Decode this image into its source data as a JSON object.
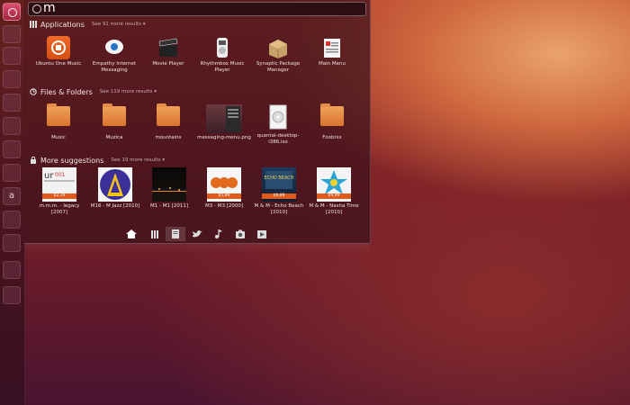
{
  "search": {
    "value": "m"
  },
  "launcher": {
    "letter_icon": "a"
  },
  "applications": {
    "title": "Applications",
    "more": "See 91 more results",
    "items": [
      {
        "label": "Ubuntu One Music",
        "icon": "ubuntu-one-music-icon"
      },
      {
        "label": "Empathy Internet Messaging",
        "icon": "empathy-icon"
      },
      {
        "label": "Movie Player",
        "icon": "clapperboard-icon"
      },
      {
        "label": "Rhythmbox Music Player",
        "icon": "rhythmbox-icon"
      },
      {
        "label": "Synaptic Package Manager",
        "icon": "package-icon"
      },
      {
        "label": "Main Menu",
        "icon": "main-menu-icon"
      }
    ]
  },
  "files": {
    "title": "Files & Folders",
    "more": "See 119 more results",
    "items": [
      {
        "label": "Music"
      },
      {
        "label": "Muzica"
      },
      {
        "label": "mountains"
      },
      {
        "label": "messaging-menu.png"
      },
      {
        "label": "quantal-desktop-i386.iso"
      },
      {
        "label": "Foobnix"
      }
    ]
  },
  "suggestions": {
    "title": "More suggestions",
    "more": "See 19 more results",
    "items": [
      {
        "label": "m.m.m. - legacy [2007]",
        "price": "$2,39"
      },
      {
        "label": "M16 - M Jazz [2010]",
        "price": ""
      },
      {
        "label": "M1 - M1 [2011]",
        "price": ""
      },
      {
        "label": "M3 - M3 [2000]",
        "price": "$5,89"
      },
      {
        "label": "M & M - Echo Beach [2010]",
        "price": "$9,89",
        "art_text": "ECHO BEACH"
      },
      {
        "label": "M & M - Nasha Time [2010]",
        "price": "$9,89"
      }
    ]
  },
  "lens_bar": [
    "home-lens",
    "applications-lens",
    "files-lens",
    "social-lens",
    "music-lens",
    "photos-lens",
    "video-lens"
  ],
  "colors": {
    "accent": "#dd4814",
    "dash_bg": "#3c121c"
  }
}
